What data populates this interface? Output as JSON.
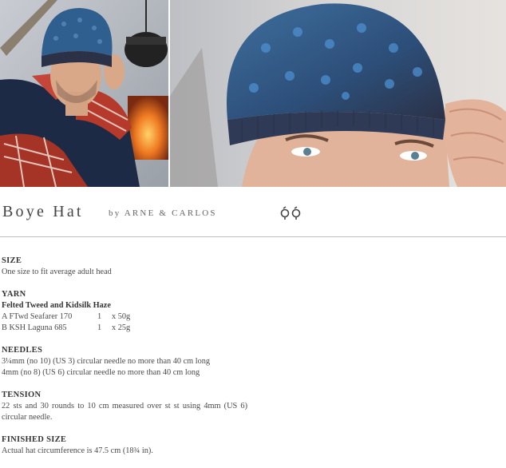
{
  "pattern": {
    "title": "Boye Hat",
    "byline": "by ARNE & CARLOS",
    "rating_icon": "two-balls-of-yarn-icon"
  },
  "photos": [
    {
      "name": "photo-man-by-campfire"
    },
    {
      "name": "photo-hat-closeup"
    }
  ],
  "colors": {
    "hat_blue": "#2f5f8e",
    "hat_dark": "#2b3146",
    "plaid_red": "#b63a2b",
    "vest_navy": "#1d2a45",
    "rule": "#bdbdbd"
  },
  "sections": {
    "size": {
      "heading": "SIZE",
      "text": "One size to fit average adult head"
    },
    "yarn": {
      "heading": "YARN",
      "subheading": "Felted Tweed and Kidsilk Haze",
      "rows": [
        {
          "name": "A FTwd Seafarer 170",
          "qty": "1",
          "weight": "x 50g"
        },
        {
          "name": "B KSH Laguna 685",
          "qty": "1",
          "weight": "x 25g"
        }
      ]
    },
    "needles": {
      "heading": "NEEDLES",
      "lines": [
        "3¼mm (no 10) (US 3) circular needle no more than 40 cm long",
        "4mm (no 8) (US 6) circular needle no more than 40 cm long"
      ]
    },
    "tension": {
      "heading": "TENSION",
      "text": "22 sts and 30 rounds to 10 cm measured over st st using 4mm (US 6) circular needle."
    },
    "finished_size": {
      "heading": "FINISHED SIZE",
      "text": "Actual hat circumference is 47.5 cm (18¾ in)."
    }
  }
}
